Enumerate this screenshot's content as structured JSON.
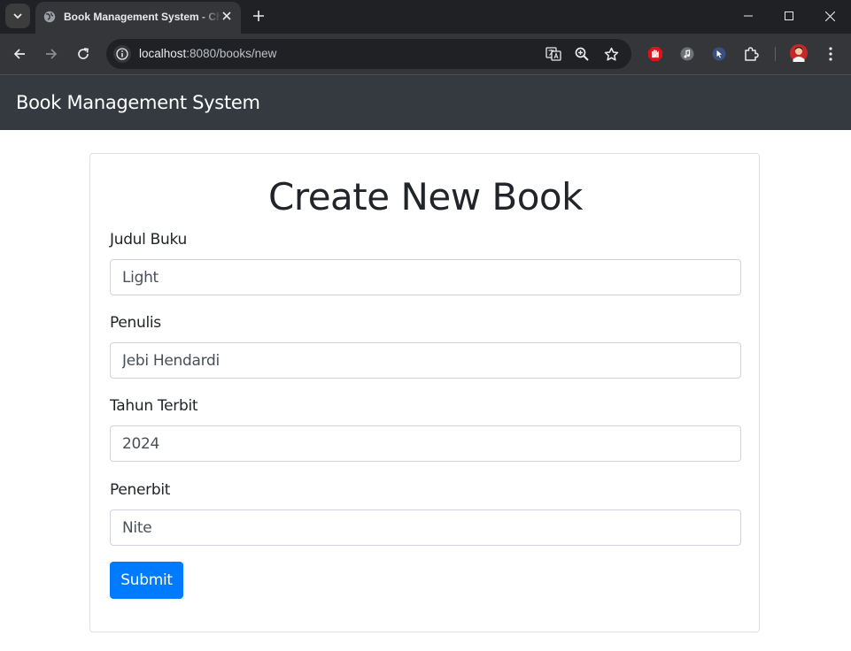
{
  "browser": {
    "tab_title": "Book Management System - Chrome",
    "url_host": "localhost",
    "url_rest": ":8080/books/new",
    "icons": [
      "tab-search-icon",
      "globe-icon",
      "close-icon",
      "plus-icon",
      "minimize-icon",
      "maximize-icon",
      "close-window-icon",
      "back-icon",
      "forward-icon",
      "reload-icon",
      "site-info-icon",
      "translate-icon",
      "zoom-icon",
      "star-icon",
      "adblock-extension-icon",
      "music-extension-icon",
      "cursor-extension-icon",
      "puzzle-icon",
      "profile-avatar",
      "kebab-menu-icon"
    ]
  },
  "app": {
    "brand": "Book Management System"
  },
  "form": {
    "heading": "Create New Book",
    "fields": [
      {
        "label": "Judul Buku",
        "value": "Light"
      },
      {
        "label": "Penulis",
        "value": "Jebi Hendardi"
      },
      {
        "label": "Tahun Terbit",
        "value": "2024"
      },
      {
        "label": "Penerbit",
        "value": "Nite"
      }
    ],
    "submit_label": "Submit"
  },
  "colors": {
    "navbar": "#343a40",
    "primary": "#007bff",
    "chrome_dark": "#202124",
    "chrome_toolbar": "#35363a"
  }
}
